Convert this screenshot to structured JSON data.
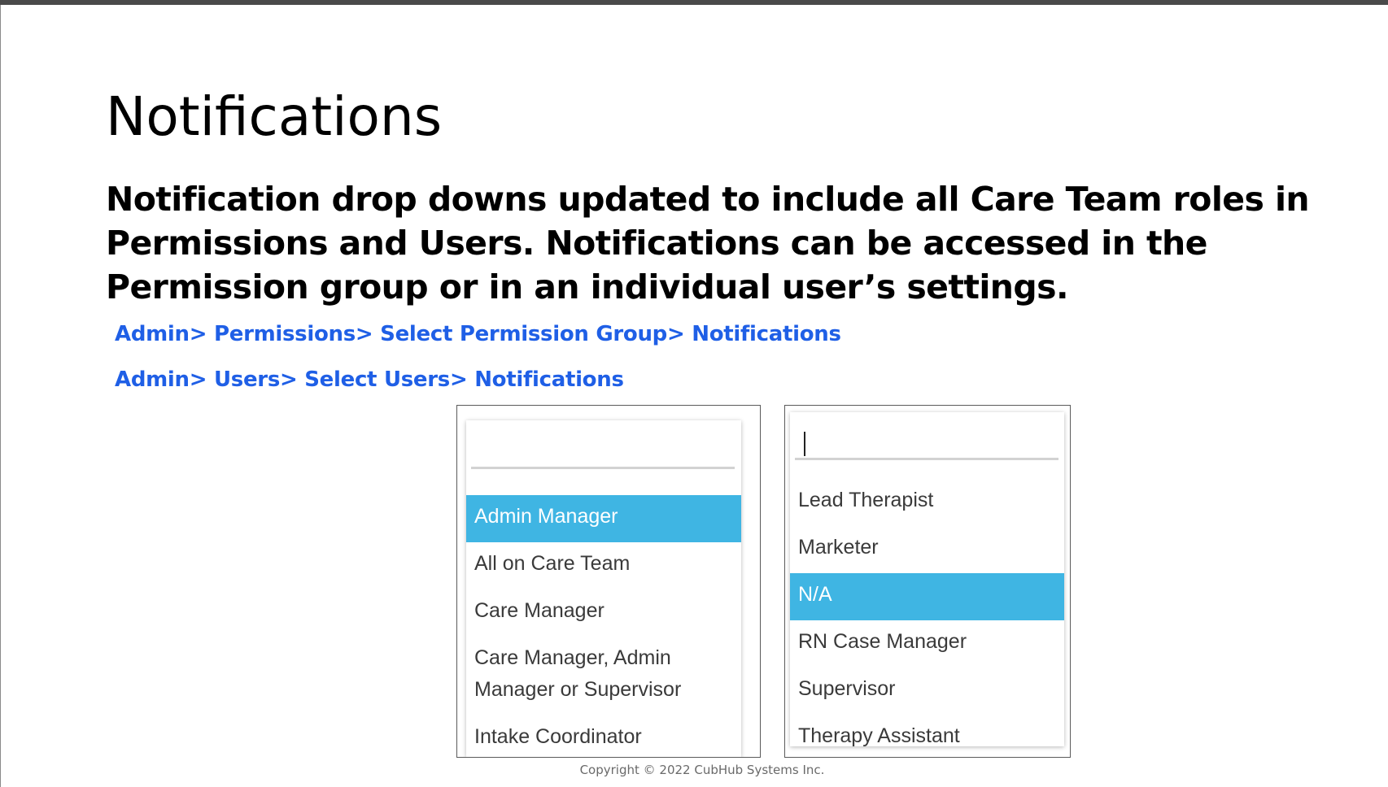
{
  "slide": {
    "title": "Notifications",
    "subtitle": "Notification drop downs updated to include all Care Team roles in Permissions and Users. Notifications can be accessed in the Permission group or in an individual user’s settings.",
    "paths": [
      "Admin> Permissions> Select Permission Group> Notifications",
      "Admin> Users> Select Users> Notifications"
    ],
    "footer": "Copyright © 2022 CubHub Systems Inc."
  },
  "colors": {
    "path_link": "#1f5fe6",
    "selected_option": "#3fb5e3"
  },
  "dropdown_left": {
    "search_value": "",
    "options": [
      "Admin Manager",
      "All on Care Team",
      "Care Manager",
      "Care Manager, Admin Manager or Supervisor",
      "Intake Coordinator"
    ],
    "selected": "Admin Manager"
  },
  "dropdown_right": {
    "search_value": "",
    "options": [
      "Lead Therapist",
      "Marketer",
      "N/A",
      "RN Case Manager",
      "Supervisor",
      "Therapy Assistant"
    ],
    "selected": "N/A"
  }
}
